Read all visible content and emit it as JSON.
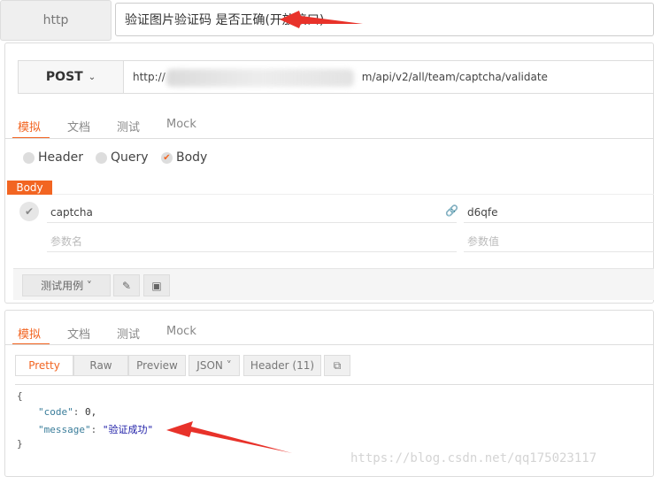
{
  "header": {
    "protocol": "http",
    "title": "验证图片验证码 是否正确(开放接口)"
  },
  "request": {
    "method": "POST",
    "url_prefix": "http://",
    "url_suffix": "m/api/v2/all/team/captcha/validate",
    "tabs": [
      "模拟",
      "文档",
      "测试",
      "Mock"
    ],
    "active_tab": "模拟",
    "radios": [
      "Header",
      "Query",
      "Body"
    ],
    "selected_radio": "Body",
    "body_badge": "Body",
    "params": [
      {
        "name": "captcha",
        "value": "d6qfe"
      }
    ],
    "name_placeholder": "参数名",
    "value_placeholder": "参数值",
    "test_case_label": "测试用例 ˅"
  },
  "response": {
    "tabs": [
      "模拟",
      "文档",
      "测试",
      "Mock"
    ],
    "active_tab": "模拟",
    "view_buttons": [
      "Pretty",
      "Raw",
      "Preview",
      "JSON ˅",
      "Header (11)"
    ],
    "active_view": "Pretty",
    "code_lines": {
      "open": "{",
      "code_key": "\"code\"",
      "code_val": "0,",
      "msg_key": "\"message\"",
      "msg_val": "\"验证成功\"",
      "close": "}"
    }
  },
  "watermark": "https://blog.csdn.net/qq175023117",
  "colors": {
    "accent": "#f26522",
    "arrow": "#e8322a"
  }
}
